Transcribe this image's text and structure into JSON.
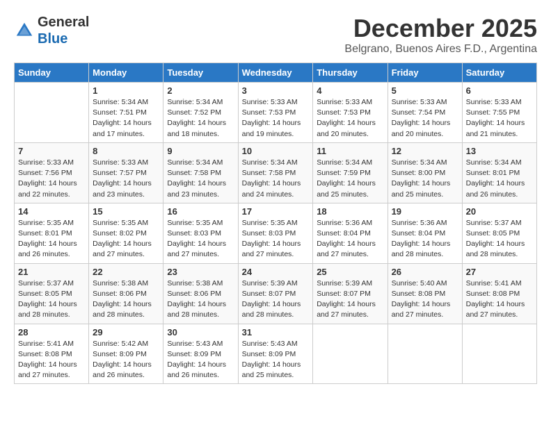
{
  "header": {
    "logo_line1": "General",
    "logo_line2": "Blue",
    "month_title": "December 2025",
    "subtitle": "Belgrano, Buenos Aires F.D., Argentina"
  },
  "columns": [
    "Sunday",
    "Monday",
    "Tuesday",
    "Wednesday",
    "Thursday",
    "Friday",
    "Saturday"
  ],
  "weeks": [
    [
      {
        "day": "",
        "sunrise": "",
        "sunset": "",
        "daylight": ""
      },
      {
        "day": "1",
        "sunrise": "Sunrise: 5:34 AM",
        "sunset": "Sunset: 7:51 PM",
        "daylight": "Daylight: 14 hours and 17 minutes."
      },
      {
        "day": "2",
        "sunrise": "Sunrise: 5:34 AM",
        "sunset": "Sunset: 7:52 PM",
        "daylight": "Daylight: 14 hours and 18 minutes."
      },
      {
        "day": "3",
        "sunrise": "Sunrise: 5:33 AM",
        "sunset": "Sunset: 7:53 PM",
        "daylight": "Daylight: 14 hours and 19 minutes."
      },
      {
        "day": "4",
        "sunrise": "Sunrise: 5:33 AM",
        "sunset": "Sunset: 7:53 PM",
        "daylight": "Daylight: 14 hours and 20 minutes."
      },
      {
        "day": "5",
        "sunrise": "Sunrise: 5:33 AM",
        "sunset": "Sunset: 7:54 PM",
        "daylight": "Daylight: 14 hours and 20 minutes."
      },
      {
        "day": "6",
        "sunrise": "Sunrise: 5:33 AM",
        "sunset": "Sunset: 7:55 PM",
        "daylight": "Daylight: 14 hours and 21 minutes."
      }
    ],
    [
      {
        "day": "7",
        "sunrise": "Sunrise: 5:33 AM",
        "sunset": "Sunset: 7:56 PM",
        "daylight": "Daylight: 14 hours and 22 minutes."
      },
      {
        "day": "8",
        "sunrise": "Sunrise: 5:33 AM",
        "sunset": "Sunset: 7:57 PM",
        "daylight": "Daylight: 14 hours and 23 minutes."
      },
      {
        "day": "9",
        "sunrise": "Sunrise: 5:34 AM",
        "sunset": "Sunset: 7:58 PM",
        "daylight": "Daylight: 14 hours and 23 minutes."
      },
      {
        "day": "10",
        "sunrise": "Sunrise: 5:34 AM",
        "sunset": "Sunset: 7:58 PM",
        "daylight": "Daylight: 14 hours and 24 minutes."
      },
      {
        "day": "11",
        "sunrise": "Sunrise: 5:34 AM",
        "sunset": "Sunset: 7:59 PM",
        "daylight": "Daylight: 14 hours and 25 minutes."
      },
      {
        "day": "12",
        "sunrise": "Sunrise: 5:34 AM",
        "sunset": "Sunset: 8:00 PM",
        "daylight": "Daylight: 14 hours and 25 minutes."
      },
      {
        "day": "13",
        "sunrise": "Sunrise: 5:34 AM",
        "sunset": "Sunset: 8:01 PM",
        "daylight": "Daylight: 14 hours and 26 minutes."
      }
    ],
    [
      {
        "day": "14",
        "sunrise": "Sunrise: 5:35 AM",
        "sunset": "Sunset: 8:01 PM",
        "daylight": "Daylight: 14 hours and 26 minutes."
      },
      {
        "day": "15",
        "sunrise": "Sunrise: 5:35 AM",
        "sunset": "Sunset: 8:02 PM",
        "daylight": "Daylight: 14 hours and 27 minutes."
      },
      {
        "day": "16",
        "sunrise": "Sunrise: 5:35 AM",
        "sunset": "Sunset: 8:03 PM",
        "daylight": "Daylight: 14 hours and 27 minutes."
      },
      {
        "day": "17",
        "sunrise": "Sunrise: 5:35 AM",
        "sunset": "Sunset: 8:03 PM",
        "daylight": "Daylight: 14 hours and 27 minutes."
      },
      {
        "day": "18",
        "sunrise": "Sunrise: 5:36 AM",
        "sunset": "Sunset: 8:04 PM",
        "daylight": "Daylight: 14 hours and 27 minutes."
      },
      {
        "day": "19",
        "sunrise": "Sunrise: 5:36 AM",
        "sunset": "Sunset: 8:04 PM",
        "daylight": "Daylight: 14 hours and 28 minutes."
      },
      {
        "day": "20",
        "sunrise": "Sunrise: 5:37 AM",
        "sunset": "Sunset: 8:05 PM",
        "daylight": "Daylight: 14 hours and 28 minutes."
      }
    ],
    [
      {
        "day": "21",
        "sunrise": "Sunrise: 5:37 AM",
        "sunset": "Sunset: 8:05 PM",
        "daylight": "Daylight: 14 hours and 28 minutes."
      },
      {
        "day": "22",
        "sunrise": "Sunrise: 5:38 AM",
        "sunset": "Sunset: 8:06 PM",
        "daylight": "Daylight: 14 hours and 28 minutes."
      },
      {
        "day": "23",
        "sunrise": "Sunrise: 5:38 AM",
        "sunset": "Sunset: 8:06 PM",
        "daylight": "Daylight: 14 hours and 28 minutes."
      },
      {
        "day": "24",
        "sunrise": "Sunrise: 5:39 AM",
        "sunset": "Sunset: 8:07 PM",
        "daylight": "Daylight: 14 hours and 28 minutes."
      },
      {
        "day": "25",
        "sunrise": "Sunrise: 5:39 AM",
        "sunset": "Sunset: 8:07 PM",
        "daylight": "Daylight: 14 hours and 27 minutes."
      },
      {
        "day": "26",
        "sunrise": "Sunrise: 5:40 AM",
        "sunset": "Sunset: 8:08 PM",
        "daylight": "Daylight: 14 hours and 27 minutes."
      },
      {
        "day": "27",
        "sunrise": "Sunrise: 5:41 AM",
        "sunset": "Sunset: 8:08 PM",
        "daylight": "Daylight: 14 hours and 27 minutes."
      }
    ],
    [
      {
        "day": "28",
        "sunrise": "Sunrise: 5:41 AM",
        "sunset": "Sunset: 8:08 PM",
        "daylight": "Daylight: 14 hours and 27 minutes."
      },
      {
        "day": "29",
        "sunrise": "Sunrise: 5:42 AM",
        "sunset": "Sunset: 8:09 PM",
        "daylight": "Daylight: 14 hours and 26 minutes."
      },
      {
        "day": "30",
        "sunrise": "Sunrise: 5:43 AM",
        "sunset": "Sunset: 8:09 PM",
        "daylight": "Daylight: 14 hours and 26 minutes."
      },
      {
        "day": "31",
        "sunrise": "Sunrise: 5:43 AM",
        "sunset": "Sunset: 8:09 PM",
        "daylight": "Daylight: 14 hours and 25 minutes."
      },
      {
        "day": "",
        "sunrise": "",
        "sunset": "",
        "daylight": ""
      },
      {
        "day": "",
        "sunrise": "",
        "sunset": "",
        "daylight": ""
      },
      {
        "day": "",
        "sunrise": "",
        "sunset": "",
        "daylight": ""
      }
    ]
  ]
}
